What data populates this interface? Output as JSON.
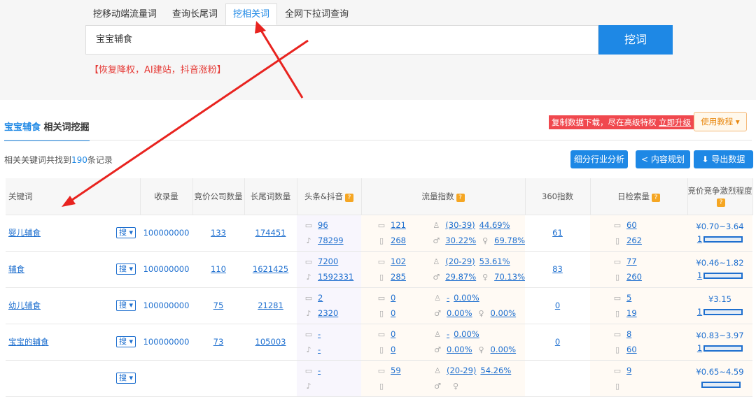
{
  "tabs": [
    "挖移动端流量词",
    "查询长尾词",
    "挖相关词",
    "全网下拉词查询"
  ],
  "search": {
    "value": "宝宝辅食",
    "button": "挖词"
  },
  "promo": "【恢复降权，AI建站，抖音涨粉】",
  "panel": {
    "keyword": "宝宝辅食",
    "title_suffix": "相关词挖掘",
    "notice": "复制数据下载，尽在高级特权",
    "upgrade": "立即升级",
    "tutorial": "使用教程 ▾",
    "count_prefix": "相关关键词共找到",
    "count": "190",
    "count_suffix": "条记录",
    "buttons": [
      "细分行业分析",
      "内容规划",
      "导出数据"
    ]
  },
  "columns": [
    "关键词",
    "收录量",
    "竞价公司数量",
    "长尾词数量",
    "头条&抖音",
    "流量指数",
    "360指数",
    "日检索量",
    "竞价竞争激烈程度"
  ],
  "search_tag": "搜 ▾",
  "rows": [
    {
      "kw": "婴儿辅食",
      "indexed": "100000000",
      "bid": "133",
      "longtail": "174451",
      "toutiao": "96",
      "douyin": "78299",
      "pc": "121",
      "mobile": "268",
      "age": "(30-39)",
      "age_pct": "44.69%",
      "male": "30.22%",
      "female": "69.78%",
      "i360": "61",
      "day_pc": "60",
      "day_m": "262",
      "price": "¥0.70~3.64",
      "level": "1"
    },
    {
      "kw": "辅食",
      "indexed": "100000000",
      "bid": "110",
      "longtail": "1621425",
      "toutiao": "7200",
      "douyin": "1592331",
      "pc": "102",
      "mobile": "285",
      "age": "(20-29)",
      "age_pct": "53.61%",
      "male": "29.87%",
      "female": "70.13%",
      "i360": "83",
      "day_pc": "77",
      "day_m": "260",
      "price": "¥0.46~1.82",
      "level": "1"
    },
    {
      "kw": "幼儿辅食",
      "indexed": "100000000",
      "bid": "75",
      "longtail": "21281",
      "toutiao": "2",
      "douyin": "2320",
      "pc": "0",
      "mobile": "0",
      "age": "-",
      "age_pct": "0.00%",
      "male": "0.00%",
      "female": "0.00%",
      "i360": "0",
      "day_pc": "5",
      "day_m": "19",
      "price": "¥3.15",
      "level": "1"
    },
    {
      "kw": "宝宝的辅食",
      "indexed": "100000000",
      "bid": "73",
      "longtail": "105003",
      "toutiao": "-",
      "douyin": "-",
      "pc": "0",
      "mobile": "0",
      "age": "-",
      "age_pct": "0.00%",
      "male": "0.00%",
      "female": "0.00%",
      "i360": "0",
      "day_pc": "8",
      "day_m": "60",
      "price": "¥0.83~3.97",
      "level": "1"
    },
    {
      "kw": "",
      "indexed": "",
      "bid": "",
      "longtail": "",
      "toutiao": "-",
      "douyin": "",
      "pc": "59",
      "mobile": "",
      "age": "(20-29)",
      "age_pct": "54.26%",
      "male": "",
      "female": "",
      "i360": "",
      "day_pc": "9",
      "day_m": "",
      "price": "¥0.65~4.59",
      "level": ""
    }
  ]
}
